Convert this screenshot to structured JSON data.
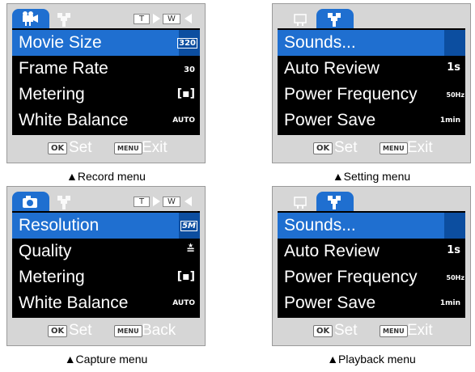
{
  "panels": [
    {
      "id": "record",
      "tabs": {
        "active": "video-camera",
        "inactive": "wrench"
      },
      "mode_chips": [
        "T",
        "W"
      ],
      "items": [
        {
          "label": "Movie Size",
          "value": "320",
          "selected": true
        },
        {
          "label": "Frame Rate",
          "value": "30"
        },
        {
          "label": "Metering",
          "value": "[▪]"
        },
        {
          "label": "White Balance",
          "value": "AUTO"
        }
      ],
      "footer": {
        "ok_key": "OK",
        "ok_label": "Set",
        "menu_key": "MENU",
        "menu_label": "Exit"
      },
      "caption": "▲Record menu"
    },
    {
      "id": "setting",
      "tabs": {
        "active": "wrench",
        "inactive": "video-camera"
      },
      "items": [
        {
          "label": "Sounds...",
          "value": "",
          "selected": true
        },
        {
          "label": "Auto Review",
          "value": "1s"
        },
        {
          "label": "Power Frequency",
          "value": "50Hz"
        },
        {
          "label": "Power Save",
          "value": "1min"
        }
      ],
      "footer": {
        "ok_key": "OK",
        "ok_label": "Set",
        "menu_key": "MENU",
        "menu_label": "Exit"
      },
      "caption": "▲Setting menu"
    },
    {
      "id": "capture",
      "tabs": {
        "active": "camera",
        "inactive": "wrench"
      },
      "mode_chips": [
        "T",
        "W"
      ],
      "items": [
        {
          "label": "Resolution",
          "value": "5M",
          "selected": true
        },
        {
          "label": "Quality",
          "value": "≛"
        },
        {
          "label": "Metering",
          "value": "[▪]"
        },
        {
          "label": "White Balance",
          "value": "AUTO"
        }
      ],
      "footer": {
        "ok_key": "OK",
        "ok_label": "Set",
        "menu_key": "MENU",
        "menu_label": "Back"
      },
      "caption": "▲Capture menu"
    },
    {
      "id": "playback",
      "tabs": {
        "active": "wrench",
        "inactive": "playback-screen"
      },
      "items": [
        {
          "label": "Sounds...",
          "value": "",
          "selected": true
        },
        {
          "label": "Auto Review",
          "value": "1s"
        },
        {
          "label": "Power Frequency",
          "value": "50Hz"
        },
        {
          "label": "Power Save",
          "value": "1min"
        }
      ],
      "footer": {
        "ok_key": "OK",
        "ok_label": "Set",
        "menu_key": "MENU",
        "menu_label": "Exit"
      },
      "caption": "▲Playback menu"
    }
  ],
  "colors": {
    "highlight": "#1f6fd0",
    "screen": "#000000",
    "frame": "#d6d6d6"
  }
}
